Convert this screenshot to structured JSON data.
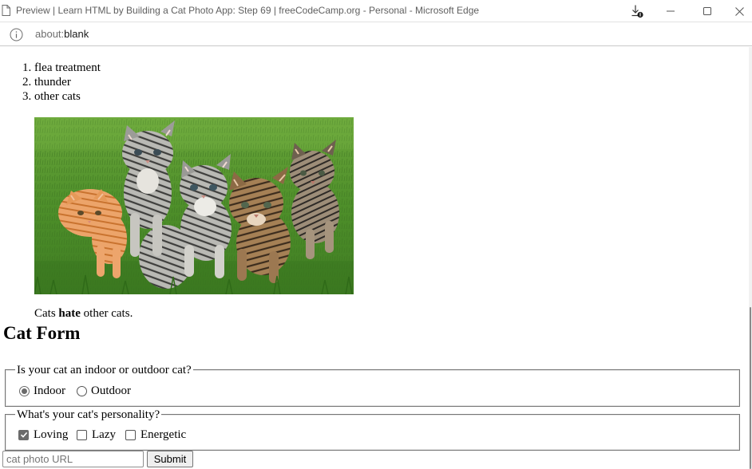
{
  "window": {
    "title": "Preview | Learn HTML by Building a Cat Photo App: Step 69 | freeCodeCamp.org - Personal - Microsoft Edge",
    "icons": [
      "page-icon",
      "download-icon",
      "minimize-icon",
      "maximize-icon",
      "close-icon"
    ]
  },
  "address_bar": {
    "scheme": "about:",
    "host": "blank",
    "icon": "info-icon"
  },
  "page": {
    "list_items": [
      "flea treatment",
      "thunder",
      "other cats"
    ],
    "image_alt": "Five cats looking around a field.",
    "caption": {
      "before": "Cats",
      "strong": "hate",
      "after": "other cats."
    },
    "form_heading": "Cat Form",
    "fieldset_indoor": {
      "legend": "Is your cat an indoor or outdoor cat?",
      "options": [
        {
          "label": "Indoor",
          "checked": true
        },
        {
          "label": "Outdoor",
          "checked": false
        }
      ]
    },
    "fieldset_personality": {
      "legend": "What's your cat's personality?",
      "options": [
        {
          "label": "Loving",
          "checked": true
        },
        {
          "label": "Lazy",
          "checked": false
        },
        {
          "label": "Energetic",
          "checked": false
        }
      ]
    },
    "url_input": {
      "placeholder": "cat photo URL",
      "value": ""
    },
    "submit_label": "Submit"
  },
  "colors": {
    "grass": "#4e8f2a",
    "chrome_text": "#5f5f5f",
    "control_checked": "#6b6b6b"
  }
}
